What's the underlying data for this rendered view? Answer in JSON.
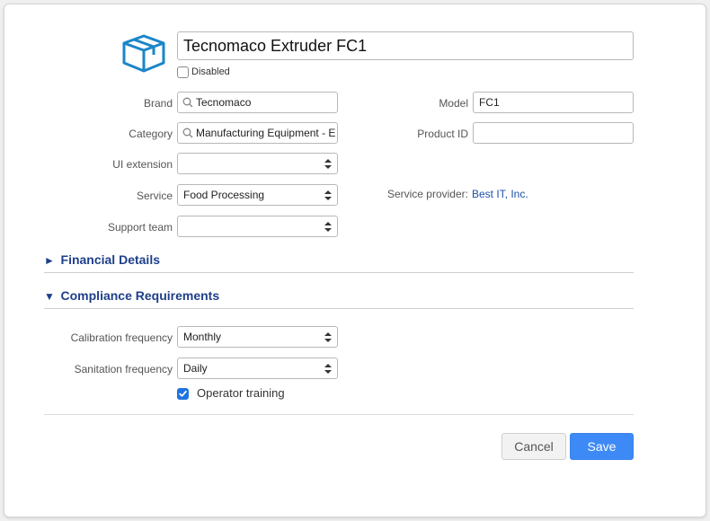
{
  "product": {
    "name": "Tecnomaco Extruder FC1",
    "disabled_label": "Disabled",
    "disabled_checked": false
  },
  "fields": {
    "brand": {
      "label": "Brand",
      "value": "Tecnomaco"
    },
    "category": {
      "label": "Category",
      "value": "Manufacturing Equipment - E"
    },
    "ui_extension": {
      "label": "UI extension",
      "value": ""
    },
    "service": {
      "label": "Service",
      "value": "Food Processing"
    },
    "support_team": {
      "label": "Support team",
      "value": ""
    },
    "model": {
      "label": "Model",
      "value": "FC1"
    },
    "product_id": {
      "label": "Product ID",
      "value": ""
    },
    "service_provider": {
      "label": "Service provider:",
      "value": "Best IT, Inc."
    }
  },
  "sections": {
    "financial": {
      "marker": "►",
      "title": "Financial Details",
      "expanded": false
    },
    "compliance": {
      "marker": "▼",
      "title": "Compliance Requirements",
      "expanded": true
    }
  },
  "compliance": {
    "calibration": {
      "label": "Calibration frequency",
      "value": "Monthly"
    },
    "sanitation": {
      "label": "Sanitation frequency",
      "value": "Daily"
    },
    "operator_training": {
      "label": "Operator training",
      "checked": true
    }
  },
  "actions": {
    "cancel_label": "Cancel",
    "save_label": "Save"
  },
  "colors": {
    "accent": "#3d8af7",
    "section_title": "#1e3f8a",
    "link": "#1d4fa8",
    "icon": "#1b86c8"
  },
  "icons": {
    "product": "box-icon",
    "search": "search-icon",
    "select": "select-arrows-icon",
    "check": "checkmark-icon"
  }
}
